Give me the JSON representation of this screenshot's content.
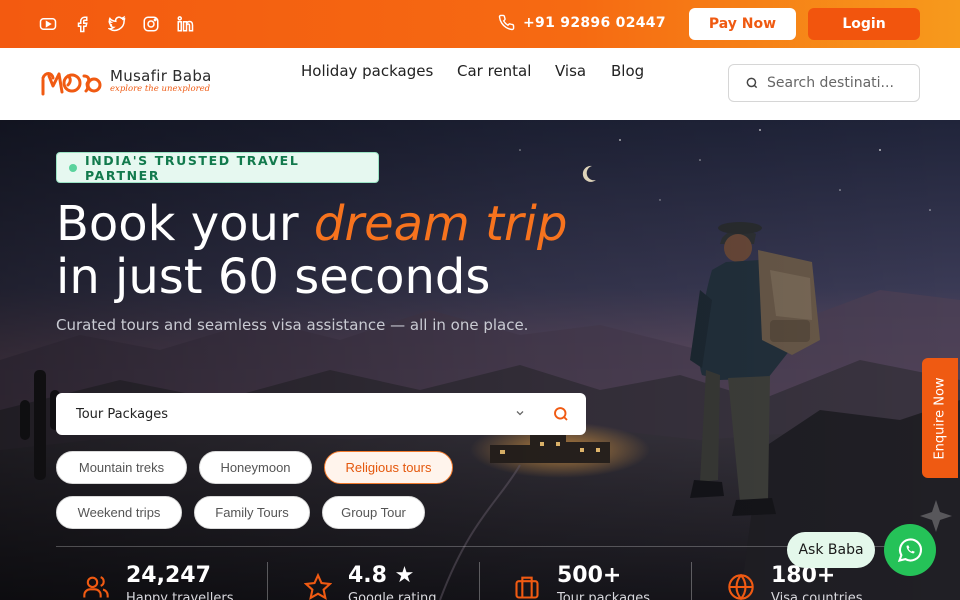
{
  "topbar": {
    "social": [
      {
        "icon": "youtube-icon"
      },
      {
        "icon": "facebook-icon"
      },
      {
        "icon": "twitter-icon"
      },
      {
        "icon": "instagram-icon"
      },
      {
        "icon": "linkedin-icon"
      }
    ],
    "phone": "+91 92896 02447",
    "pay_now": "Pay Now",
    "login": "Login"
  },
  "brand": {
    "name": "Musafir Baba",
    "tagline": "explore the unexplored"
  },
  "nav": {
    "links": [
      "Holiday packages",
      "Car rental",
      "Visa",
      "Blog"
    ],
    "search_placeholder": "Search destinati..."
  },
  "hero": {
    "badge": "INDIA'S TRUSTED TRAVEL PARTNER",
    "headline_pre": "Book your ",
    "headline_accent": "dream trip",
    "headline_line2": "in just 60 seconds",
    "subtitle": "Curated tours and seamless visa assistance — all in one place.",
    "select_value": "Tour Packages",
    "chips": [
      "Mountain treks",
      "Honeymoon",
      "Religious tours",
      "Weekend trips",
      "Family Tours",
      "Group Tour"
    ],
    "active_chip": "Religious tours"
  },
  "stats": [
    {
      "value": "24,247",
      "label": "Happy travellers",
      "icon": "users-icon"
    },
    {
      "value": "4.8 ★",
      "label": "Google rating",
      "icon": "star-icon"
    },
    {
      "value": "500+",
      "label": "Tour packages",
      "icon": "briefcase-icon"
    },
    {
      "value": "180+",
      "label": "Visa countries",
      "icon": "globe-icon"
    }
  ],
  "widgets": {
    "enquire": "Enquire Now",
    "ask_baba": "Ask Baba"
  },
  "colors": {
    "accent": "#f35a10",
    "badge_green": "#127a4d",
    "whatsapp": "#25c258"
  }
}
